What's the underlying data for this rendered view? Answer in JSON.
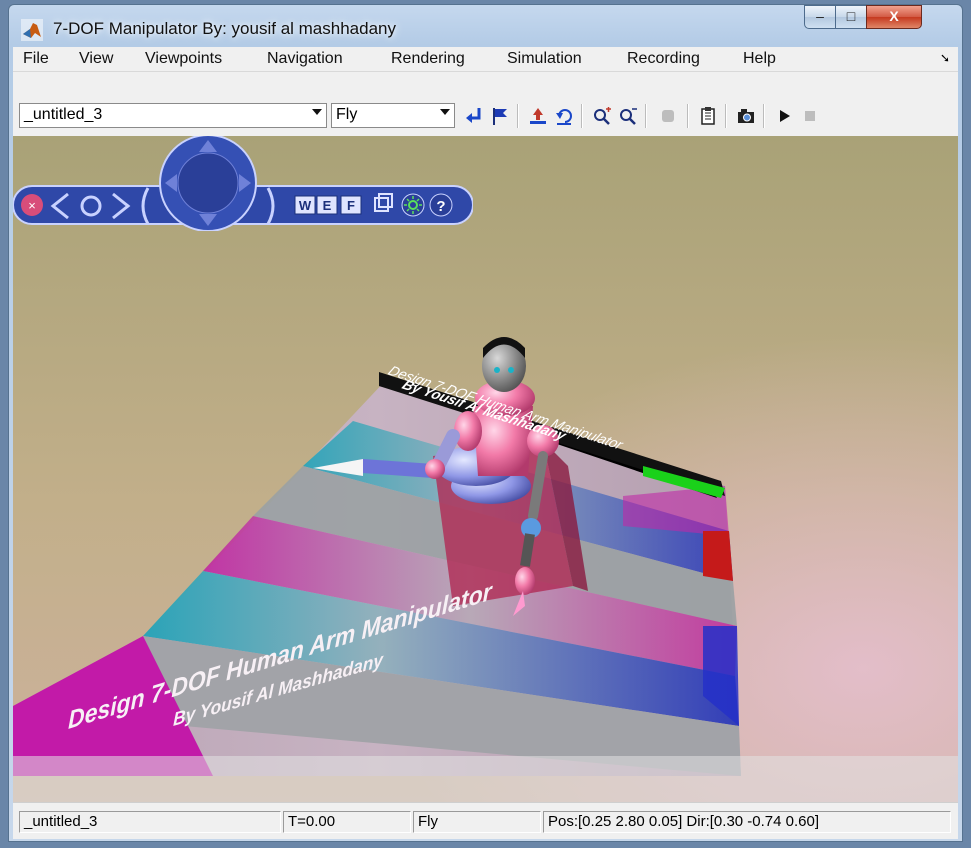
{
  "window": {
    "title": "7-DOF Manipulator By: yousif al mashhadany",
    "minimize": "–",
    "maximize": "□",
    "close": "X"
  },
  "menu": [
    "File",
    "View",
    "Viewpoints",
    "Navigation",
    "Rendering",
    "Simulation",
    "Recording",
    "Help"
  ],
  "toolbar": {
    "viewpoint_value": "_untitled_3",
    "nav_mode_value": "Fly"
  },
  "scene": {
    "floor_text_line1": "Design 7-DOF Human Arm Manipulator",
    "floor_text_line2": "By Yousif Al Mashhadany",
    "banner_text_line1": "Design 7-DOF Human Arm Manipulator",
    "banner_text_line2": "By Yousif Al Mashhadany"
  },
  "navpanel": {
    "btn_w": "W",
    "btn_e": "E",
    "btn_f": "F",
    "help": "?"
  },
  "status": {
    "viewpoint": "_untitled_3",
    "time": "T=0.00",
    "mode": "Fly",
    "position": "Pos:[0.25 2.80 0.05] Dir:[0.30 -0.74 0.60]"
  },
  "colors": {
    "menu_bg": "#f0f0f0",
    "sky_top": "#a9a277",
    "sky_bottom": "#c9ae95",
    "nav_blue": "#2f48a8"
  }
}
